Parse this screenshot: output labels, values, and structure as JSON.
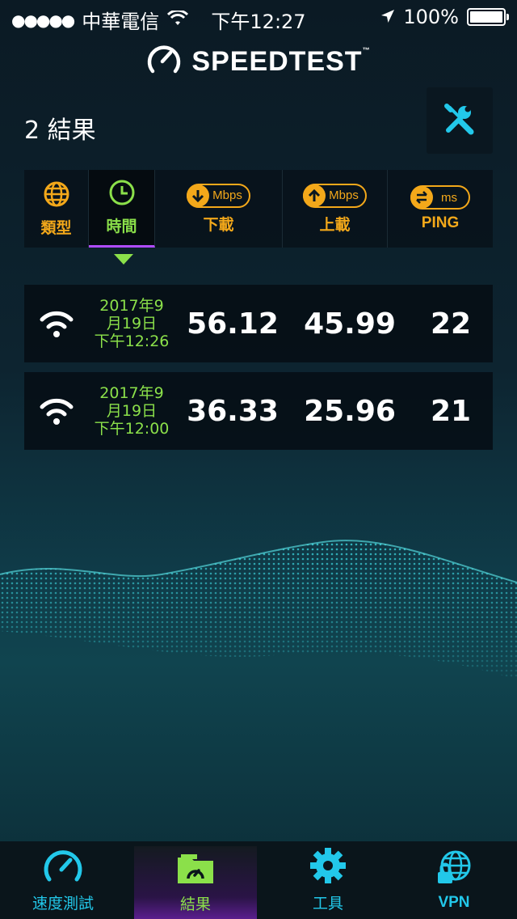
{
  "status_bar": {
    "signal_dots": "●●●●●",
    "carrier": "中華電信",
    "time": "下午12:27",
    "battery": "100%",
    "battery_level": 1.0
  },
  "app": {
    "logo_text": "SPEEDTEST",
    "trademark": "™"
  },
  "results_count": "2 結果",
  "sort_header": {
    "type_label": "類型",
    "time_label": "時間",
    "download_label": "下載",
    "download_unit": "Mbps",
    "upload_label": "上載",
    "upload_unit": "Mbps",
    "ping_label": "PING",
    "ping_unit": "ms",
    "active": "time"
  },
  "results": [
    {
      "connection": "wifi-icon",
      "date_line1": "2017年9",
      "date_line2": "月19日",
      "date_line3": "下午12:26",
      "download": "56.12",
      "upload": "45.99",
      "ping": "22"
    },
    {
      "connection": "wifi-icon",
      "date_line1": "2017年9",
      "date_line2": "月19日",
      "date_line3": "下午12:00",
      "download": "36.33",
      "upload": "25.96",
      "ping": "21"
    }
  ],
  "tabs": [
    {
      "label": "速度測試",
      "icon": "speedometer-icon"
    },
    {
      "label": "結果",
      "icon": "results-folder-icon",
      "active": true
    },
    {
      "label": "工具",
      "icon": "gear-icon"
    },
    {
      "label": "VPN",
      "icon": "vpn-globe-lock-icon"
    }
  ],
  "colors": {
    "accent_orange": "#f3a81a",
    "accent_green": "#8be04a",
    "accent_cyan": "#22c8ea",
    "accent_purple": "#b04cff"
  }
}
